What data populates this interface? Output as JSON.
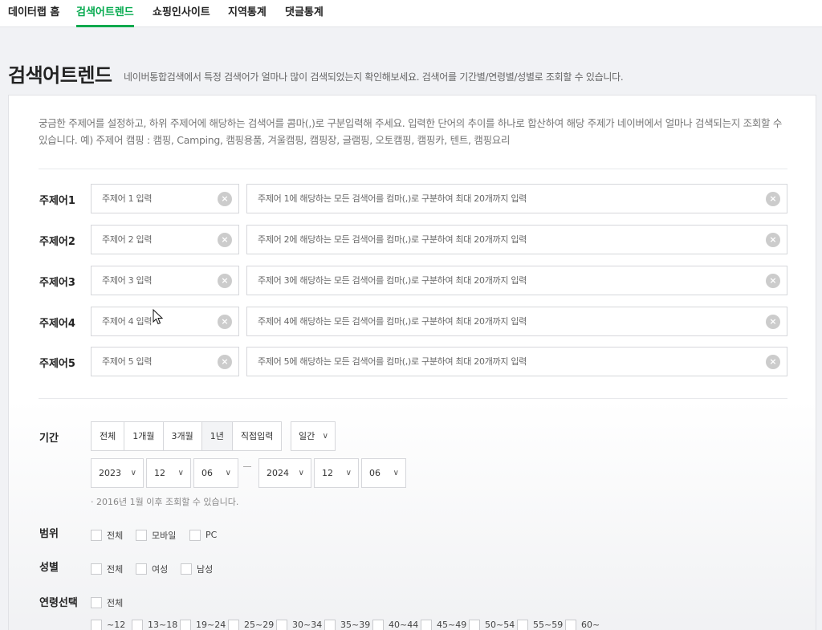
{
  "nav": {
    "tabs": [
      {
        "label": "데이터랩 홈",
        "active": false
      },
      {
        "label": "검색어트렌드",
        "active": true
      },
      {
        "label": "쇼핑인사이트",
        "active": false
      },
      {
        "label": "지역통계",
        "active": false
      },
      {
        "label": "댓글통계",
        "active": false
      }
    ]
  },
  "colors": {
    "accent": "#03a94d",
    "background": "#f1f2f5"
  },
  "page": {
    "title": "검색어트렌드",
    "description": "네이버통합검색에서 특정 검색어가 얼마나 많이 검색되었는지 확인해보세요. 검색어를 기간별/연령별/성별로 조회할 수 있습니다."
  },
  "intro": "궁금한 주제어를 설정하고, 하위 주제어에 해당하는 검색어를 콤마(,)로 구분입력해 주세요. 입력한 단어의 추이를 하나로 합산하여 해당 주제가 네이버에서 얼마나 검색되는지 조회할 수 있습니다. 예) 주제어 캠핑 : 캠핑, Camping, 캠핑용품, 겨울캠핑, 캠핑장, 글램핑, 오토캠핑, 캠핑카, 텐트, 캠핑요리",
  "themes": [
    {
      "label": "주제어1",
      "topic_placeholder": "주제어 1 입력",
      "keywords_placeholder": "주제어 1에 해당하는 모든 검색어를 컴마(,)로 구분하여 최대 20개까지 입력"
    },
    {
      "label": "주제어2",
      "topic_placeholder": "주제어 2 입력",
      "keywords_placeholder": "주제어 2에 해당하는 모든 검색어를 컴마(,)로 구분하여 최대 20개까지 입력"
    },
    {
      "label": "주제어3",
      "topic_placeholder": "주제어 3 입력",
      "keywords_placeholder": "주제어 3에 해당하는 모든 검색어를 컴마(,)로 구분하여 최대 20개까지 입력"
    },
    {
      "label": "주제어4",
      "topic_placeholder": "주제어 4 입력",
      "keywords_placeholder": "주제어 4에 해당하는 모든 검색어를 컴마(,)로 구분하여 최대 20개까지 입력"
    },
    {
      "label": "주제어5",
      "topic_placeholder": "주제어 5 입력",
      "keywords_placeholder": "주제어 5에 해당하는 모든 검색어를 컴마(,)로 구분하여 최대 20개까지 입력"
    }
  ],
  "period": {
    "label": "기간",
    "buttons": [
      "전체",
      "1개월",
      "3개월",
      "1년",
      "직접입력"
    ],
    "selected": "1년",
    "interval": "일간",
    "start": {
      "year": "2023",
      "month": "12",
      "day": "06"
    },
    "end": {
      "year": "2024",
      "month": "12",
      "day": "06"
    },
    "note": "· 2016년 1월 이후 조회할 수 있습니다."
  },
  "scope": {
    "label": "범위",
    "options": [
      "전체",
      "모바일",
      "PC"
    ]
  },
  "gender": {
    "label": "성별",
    "options": [
      "전체",
      "여성",
      "남성"
    ]
  },
  "age": {
    "label": "연령선택",
    "all": "전체",
    "options": [
      "~12",
      "13~18",
      "19~24",
      "25~29",
      "30~34",
      "35~39",
      "40~44",
      "45~49",
      "50~54",
      "55~59",
      "60~"
    ]
  }
}
